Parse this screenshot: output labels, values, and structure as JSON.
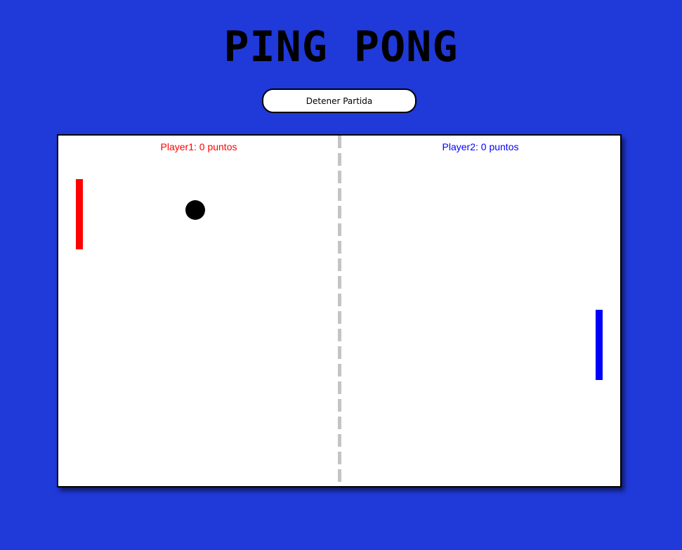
{
  "title": "PING PONG",
  "controls": {
    "stop_label": "Detener Partida"
  },
  "scoreboard": {
    "player1": {
      "label": "Player1: 0 puntos",
      "color": "#ff0000"
    },
    "player2": {
      "label": "Player2: 0 puntos",
      "color": "#0000ff"
    }
  },
  "colors": {
    "background": "#2039d9",
    "board": "#ffffff",
    "center_line": "#c4c4c4",
    "ball": "#000000",
    "paddle_left": "#ff0000",
    "paddle_right": "#0000ff"
  }
}
